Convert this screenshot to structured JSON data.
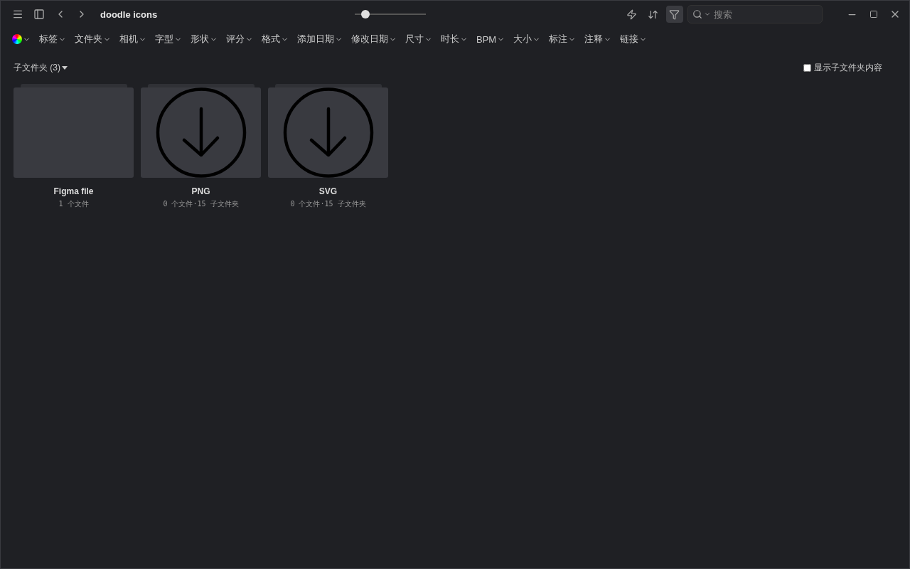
{
  "window": {
    "title": "doodle icons"
  },
  "zoom_slider": {
    "level": 0.15
  },
  "toolbar": {
    "filter_active": true,
    "search": {
      "placeholder": "搜索"
    }
  },
  "filters": [
    {
      "kind": "color"
    },
    {
      "kind": "text",
      "label": "标签"
    },
    {
      "kind": "text",
      "label": "文件夹"
    },
    {
      "kind": "text",
      "label": "相机"
    },
    {
      "kind": "text",
      "label": "字型"
    },
    {
      "kind": "text",
      "label": "形状"
    },
    {
      "kind": "text",
      "label": "评分"
    },
    {
      "kind": "text",
      "label": "格式"
    },
    {
      "kind": "text",
      "label": "添加日期"
    },
    {
      "kind": "text",
      "label": "修改日期"
    },
    {
      "kind": "text",
      "label": "尺寸"
    },
    {
      "kind": "text",
      "label": "时长"
    },
    {
      "kind": "text",
      "label": "BPM"
    },
    {
      "kind": "text",
      "label": "大小"
    },
    {
      "kind": "text",
      "label": "标注"
    },
    {
      "kind": "text",
      "label": "注释"
    },
    {
      "kind": "text",
      "label": "链接"
    }
  ],
  "section": {
    "title": "子文件夹 (3)",
    "show_subfolder_content": {
      "label": "显示子文件夹内容",
      "checked": false
    }
  },
  "folders": [
    {
      "name": "Figma file",
      "info": "1 个文件",
      "kind": "empty"
    },
    {
      "name": "PNG",
      "info": "0 个文件·15 子文件夹",
      "kind": "download"
    },
    {
      "name": "SVG",
      "info": "0 个文件·15 子文件夹",
      "kind": "download"
    }
  ]
}
